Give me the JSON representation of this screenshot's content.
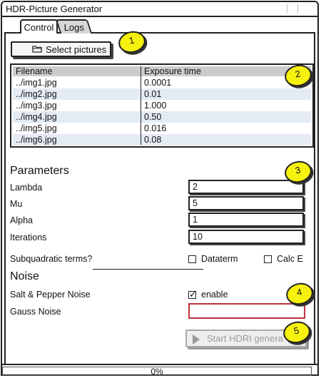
{
  "window": {
    "title": "HDR-Picture Generator"
  },
  "tabs": [
    {
      "label": "Control"
    },
    {
      "label": "Logs"
    }
  ],
  "select_button": {
    "label": "Select pictures",
    "icon": "folder-icon"
  },
  "table": {
    "columns": [
      "Filename",
      "Exposure time"
    ],
    "rows": [
      [
        "../img1.jpg",
        "0.0001"
      ],
      [
        "../img2.jpg",
        "0.01"
      ],
      [
        "../img3.jpg",
        "1.000"
      ],
      [
        "../img4.jpg",
        "0.50"
      ],
      [
        "../img5.jpg",
        "0.016"
      ],
      [
        "../img6.jpg",
        "0.08"
      ]
    ]
  },
  "parameters": {
    "heading": "Parameters",
    "lambda": {
      "label": "Lambda",
      "value": "2"
    },
    "mu": {
      "label": "Mu",
      "value": "5"
    },
    "alpha": {
      "label": "Alpha",
      "value": "1"
    },
    "iterations": {
      "label": "Iterations",
      "value": "10"
    },
    "subquadratic": {
      "label": "Subquadratic terms?",
      "dataterm": "Dataterm",
      "calc_e": "Calc E",
      "dataterm_checked": false,
      "calc_e_checked": false
    }
  },
  "noise": {
    "heading": "Noise",
    "salt_pepper": {
      "label": "Salt & Pepper Noise",
      "enable_label": "enable",
      "checked": true
    },
    "gauss": {
      "label": "Gauss Noise",
      "value": ""
    }
  },
  "start_button": {
    "label": "Start HDRI genera"
  },
  "progress": {
    "text": "0%",
    "value": 0
  },
  "badges": [
    "1",
    "2",
    "3",
    "4",
    "5"
  ],
  "colors": {
    "badge": "#f7f10e",
    "error_border": "#c0303a",
    "table_alt": "#e4ebf5"
  }
}
